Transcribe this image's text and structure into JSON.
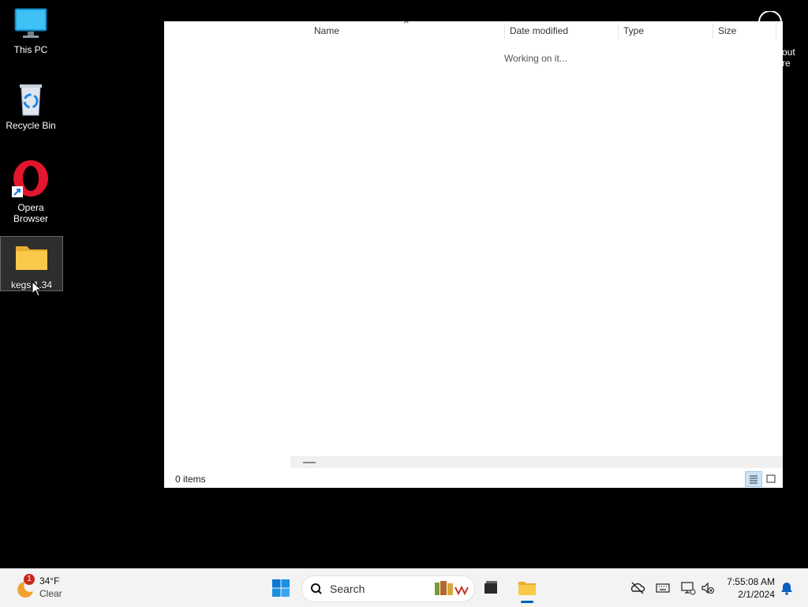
{
  "desktop": {
    "icons": [
      {
        "label": "This PC"
      },
      {
        "label": "Recycle Bin"
      },
      {
        "label": "Opera Browser"
      },
      {
        "label": "kegs.1.34"
      }
    ]
  },
  "explorer": {
    "columns": [
      "Name",
      "Date modified",
      "Type",
      "Size"
    ],
    "loading_text": "Working on it...",
    "status_text": "0 items",
    "tab_close_glyph": "×"
  },
  "overflow_text": {
    "line1": "out",
    "line2": "re"
  },
  "taskbar": {
    "weather": {
      "temp": "34°F",
      "condition": "Clear",
      "badge": "1"
    },
    "search_label": "Search",
    "clock": {
      "time": "7:55:08 AM",
      "date": "2/1/2024"
    }
  },
  "colors": {
    "accent": "#005fb8",
    "folder": "#f8c94a",
    "opera": "#e3162e",
    "taskbar_bg": "#f3f3f3"
  }
}
